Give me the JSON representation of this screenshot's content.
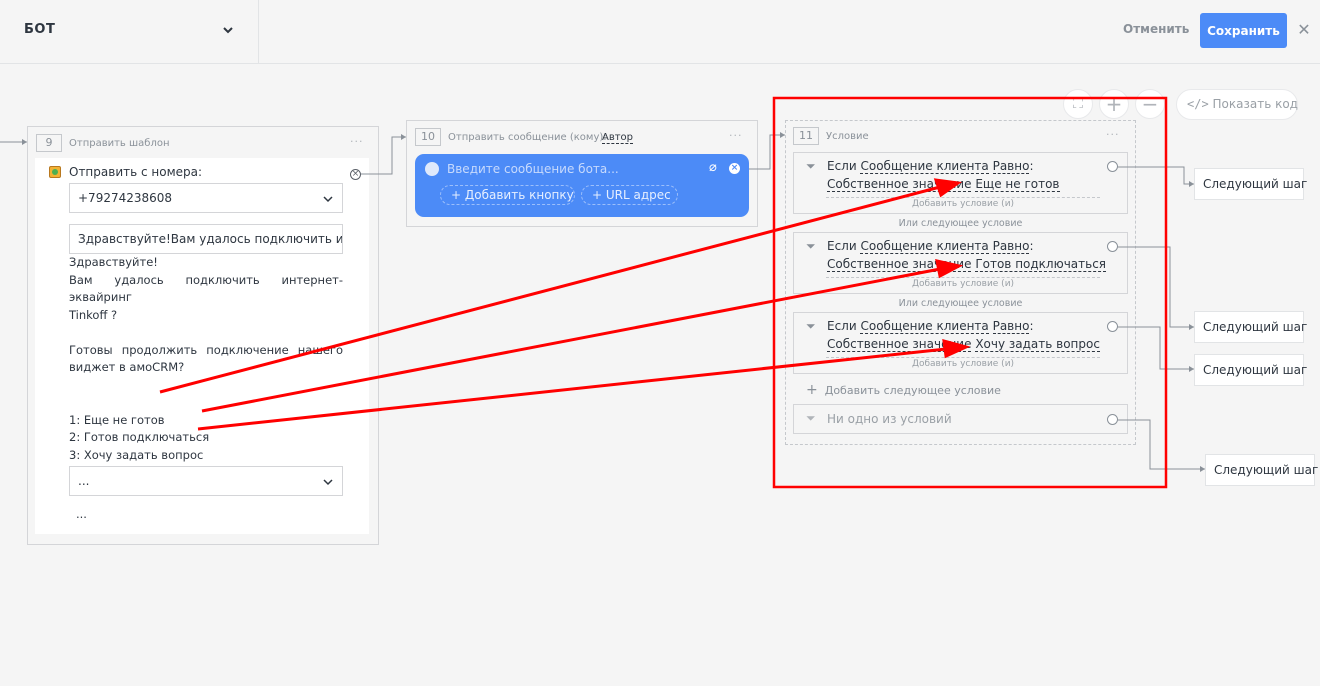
{
  "header": {
    "title": "БОТ",
    "cancel_label": "Отменить",
    "save_label": "Сохранить"
  },
  "canvas_controls": {
    "show_code_label": "Показать код"
  },
  "template_block": {
    "number": "9",
    "title": "Отправить шаблон",
    "menu": "···",
    "from_label": "Отправить с номера:",
    "phone": "+79274238608",
    "template_value": "Здравствуйте!Вам удалось подключить интер",
    "message_lines": [
      "Здравствуйте!",
      "Вам удалось подключить интернет-эквайринг",
      "Tinkoff ?",
      "",
      "Готовы продолжить подключение нашего",
      "виджет в амоCRM?",
      "",
      "",
      "1: Еще не готов",
      "2: Готов подключаться",
      "3: Хочу задать вопрос"
    ],
    "select_value": "...",
    "extra": "..."
  },
  "message_block": {
    "number": "10",
    "title": "Отправить сообщение (кому):",
    "recipient": "Автор",
    "menu": "···",
    "placeholder": "Введите сообщение бота...",
    "add_button_label": "Добавить кнопку",
    "url_label": "URL адрес"
  },
  "condition_block": {
    "number": "11",
    "title": "Условие",
    "menu": "···",
    "conditions": [
      {
        "if": "Если",
        "field": "Сообщение клиента",
        "op": "Равно",
        "sep": ":",
        "valtype": "Собственное значение",
        "value": "Еще не готов",
        "add_sub": "Добавить условие (и)"
      },
      {
        "if": "Если",
        "field": "Сообщение клиента",
        "op": "Равно",
        "sep": ":",
        "valtype": "Собственное значение",
        "value": "Готов подключаться",
        "add_sub": "Добавить условие (и)"
      },
      {
        "if": "Если",
        "field": "Сообщение клиента",
        "op": "Равно",
        "sep": ":",
        "valtype": "Собственное значение",
        "value": "Хочу задать вопрос",
        "add_sub": "Добавить условие (и)"
      }
    ],
    "or_next": "Или следующее условие",
    "add_next": "Добавить следующее условие",
    "none_of": "Ни одно из условий"
  },
  "next_step_label": "Следующий шаг",
  "colors": {
    "primary": "#4c8bf7",
    "annotation": "#ff0000"
  }
}
